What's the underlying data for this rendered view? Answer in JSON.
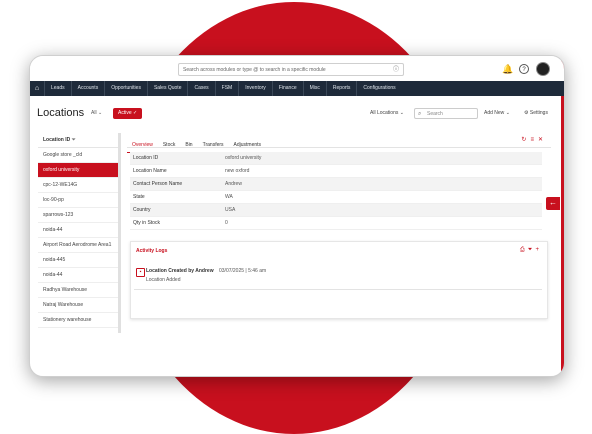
{
  "search": {
    "placeholder": "Search across modules or type @ to search in a specific module"
  },
  "nav": [
    "Leads",
    "Accounts",
    "Opportunities",
    "Sales Quote",
    "Cases",
    "FSM",
    "Inventory",
    "Finance",
    "Misc",
    "Reports",
    "Configurations"
  ],
  "header": {
    "title": "Locations",
    "filter": "All",
    "active_label": "Active ✓",
    "loc_dropdown": "All Locations",
    "search_placeholder": "Search",
    "add_new": "Add New",
    "settings": "Settings"
  },
  "sidebar": {
    "heading": "Location ID",
    "items": [
      "Google store _cld",
      "oxford university",
      "cpc-12-WE14G",
      "loc-90-pp",
      "sparrows-123",
      "noida-44",
      "Airport Road Aerodrome Area1",
      "noida-445",
      "noida-44",
      "Radhya Warehouse",
      "Natraj Warehouse",
      "Stationery warehouse"
    ]
  },
  "tabs": [
    "Overview",
    "Stock",
    "Bin",
    "Transfers",
    "Adjustments"
  ],
  "details": [
    {
      "k": "Location ID",
      "v": "oxford university"
    },
    {
      "k": "Location Name",
      "v": "new oxford"
    },
    {
      "k": "Contact Person Name",
      "v": "Andrew"
    },
    {
      "k": "State",
      "v": "WA"
    },
    {
      "k": "Country",
      "v": "USA"
    },
    {
      "k": "Qty in Stock",
      "v": "0"
    }
  ],
  "activity": {
    "title": "Activity Logs",
    "entry_title": "Location Created by Andrew",
    "entry_time": "03/07/2025 | 5:46 am",
    "entry_sub": "Location Added"
  },
  "colors": {
    "accent": "#c8101e",
    "navbar": "#1e2a3a"
  }
}
